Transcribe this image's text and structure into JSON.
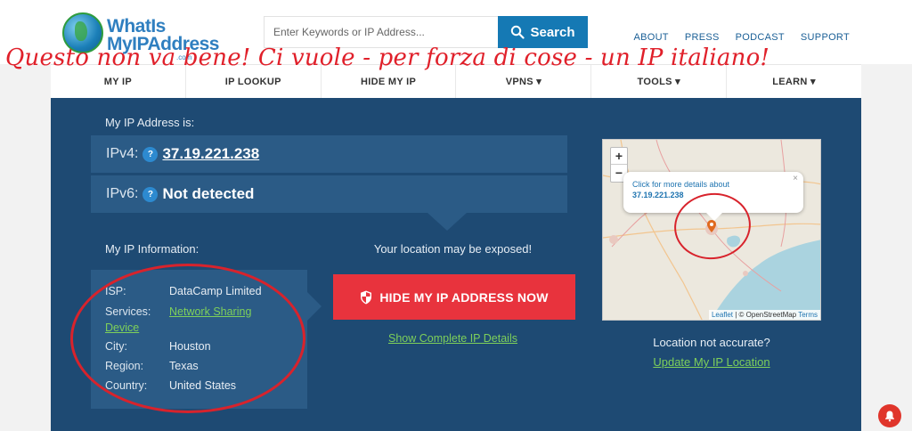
{
  "header": {
    "logo_line1": "WhatIs",
    "logo_line2": "MyIPAddress",
    "logo_suffix": ".com",
    "search_placeholder": "Enter Keywords or IP Address...",
    "search_button": "Search",
    "top_links": [
      "ABOUT",
      "PRESS",
      "PODCAST",
      "SUPPORT"
    ]
  },
  "overlay_text": "Questo non va bene! Ci vuole - per forza di cose - un IP italiano!",
  "nav": {
    "items": [
      "MY IP",
      "IP LOOKUP",
      "HIDE MY IP",
      "VPNS ▾",
      "TOOLS ▾",
      "LEARN ▾"
    ]
  },
  "main": {
    "ip_heading": "My IP Address is:",
    "ipv4_label": "IPv4:",
    "ipv4_value": "37.19.221.238",
    "ipv6_label": "IPv6:",
    "ipv6_value": "Not detected",
    "help_glyph": "?",
    "info_heading": "My IP Information:",
    "info": {
      "isp_label": "ISP:",
      "isp_value": "DataCamp Limited",
      "services_label": "Services:",
      "services_value_line1": "Network Sharing",
      "services_value_line2": "Device",
      "city_label": "City:",
      "city_value": "Houston",
      "region_label": "Region:",
      "region_value": "Texas",
      "country_label": "Country:",
      "country_value": "United States"
    },
    "exposed_text": "Your location may be exposed!",
    "hide_button": "HIDE MY IP ADDRESS NOW",
    "show_details": "Show Complete IP Details",
    "location_question": "Location not accurate?",
    "update_location": "Update My IP Location"
  },
  "map": {
    "zoom_in": "+",
    "zoom_out": "−",
    "popup_line1": "Click for more details about",
    "popup_line2": "37.19.221.238",
    "popup_close": "×",
    "attribution_leaflet": "Leaflet",
    "attribution_sep": " | © OpenStreetMap ",
    "attribution_terms": "Terms"
  },
  "colors": {
    "brand_blue": "#1579b4",
    "panel_bg": "#1e4a73",
    "panel_box": "#2b5b86",
    "link_green": "#7ed05a",
    "cta_red": "#e8333d",
    "annotation_red": "#d8232c"
  }
}
